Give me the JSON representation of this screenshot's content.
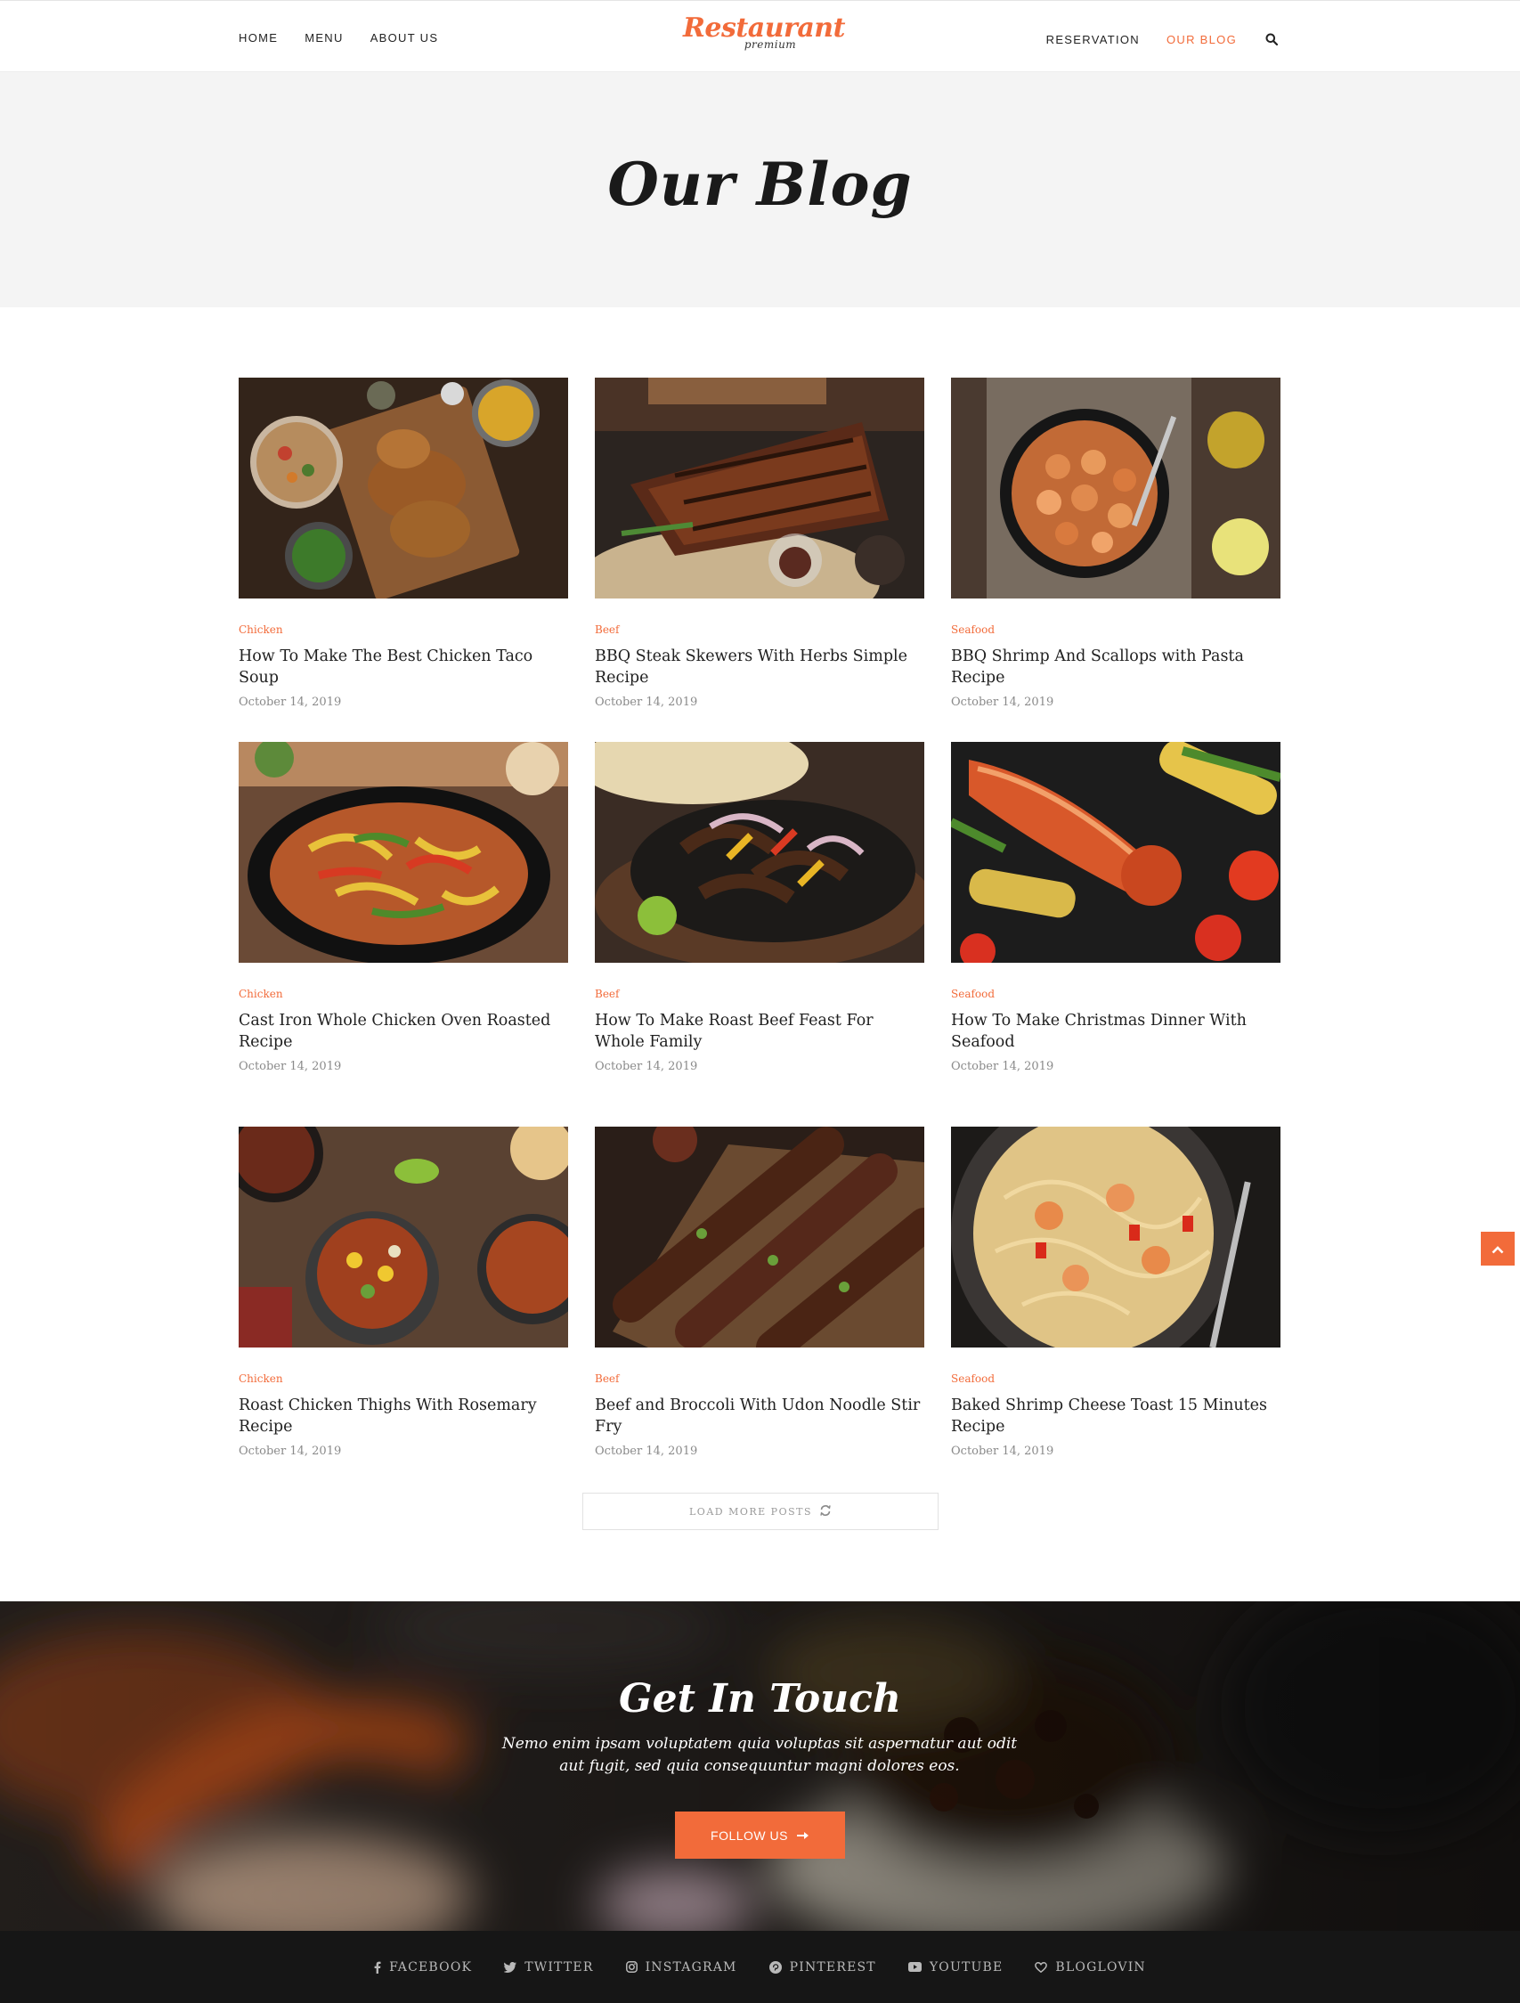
{
  "header": {
    "nav_left": [
      "HOME",
      "MENU",
      "ABOUT US"
    ],
    "nav_right": [
      "RESERVATION",
      "OUR BLOG"
    ],
    "logo_main": "Restaurant",
    "logo_sub": "premium"
  },
  "hero": {
    "title": "Our Blog"
  },
  "posts": [
    {
      "category": "Chicken",
      "title": "How To Make The Best Chicken Taco Soup",
      "date": "October 14, 2019",
      "image": "chicken-board-photo"
    },
    {
      "category": "Beef",
      "title": "BBQ Steak Skewers With Herbs Simple Recipe",
      "date": "October 14, 2019",
      "image": "grilled-steak-photo"
    },
    {
      "category": "Seafood",
      "title": "BBQ Shrimp And Scallops with Pasta Recipe",
      "date": "October 14, 2019",
      "image": "shrimp-skillet-photo"
    },
    {
      "category": "Chicken",
      "title": "Cast Iron Whole Chicken Oven Roasted Recipe",
      "date": "October 14, 2019",
      "image": "chicken-fajita-skillet-photo"
    },
    {
      "category": "Beef",
      "title": "How To Make Roast Beef Feast For Whole Family",
      "date": "October 14, 2019",
      "image": "beef-fajita-photo"
    },
    {
      "category": "Seafood",
      "title": "How To Make Christmas Dinner With Seafood",
      "date": "October 14, 2019",
      "image": "lobster-corn-photo"
    },
    {
      "category": "Chicken",
      "title": "Roast Chicken Thighs With Rosemary Recipe",
      "date": "October 14, 2019",
      "image": "chili-bowls-photo"
    },
    {
      "category": "Beef",
      "title": "Beef and Broccoli With Udon Noodle Stir Fry",
      "date": "October 14, 2019",
      "image": "beef-skewers-photo"
    },
    {
      "category": "Seafood",
      "title": "Baked Shrimp Cheese Toast 15 Minutes Recipe",
      "date": "October 14, 2019",
      "image": "shrimp-pasta-photo"
    }
  ],
  "load_more": {
    "label": "LOAD MORE POSTS",
    "icon": "refresh-icon"
  },
  "touch": {
    "title": "Get In Touch",
    "text": "Nemo enim ipsam voluptatem quia voluptas sit aspernatur aut odit aut fugit, sed quia consequuntur magni dolores eos.",
    "button": "FOLLOW US"
  },
  "social": [
    {
      "label": "FACEBOOK",
      "icon": "facebook-icon"
    },
    {
      "label": "TWITTER",
      "icon": "twitter-icon"
    },
    {
      "label": "INSTAGRAM",
      "icon": "instagram-icon"
    },
    {
      "label": "PINTEREST",
      "icon": "pinterest-icon"
    },
    {
      "label": "YOUTUBE",
      "icon": "youtube-icon"
    },
    {
      "label": "BLOGLOVIN",
      "icon": "heart-icon"
    }
  ],
  "colors": {
    "accent": "#f26b3a",
    "hero_bg": "#f4f4f4",
    "footer_bg": "#161616"
  }
}
